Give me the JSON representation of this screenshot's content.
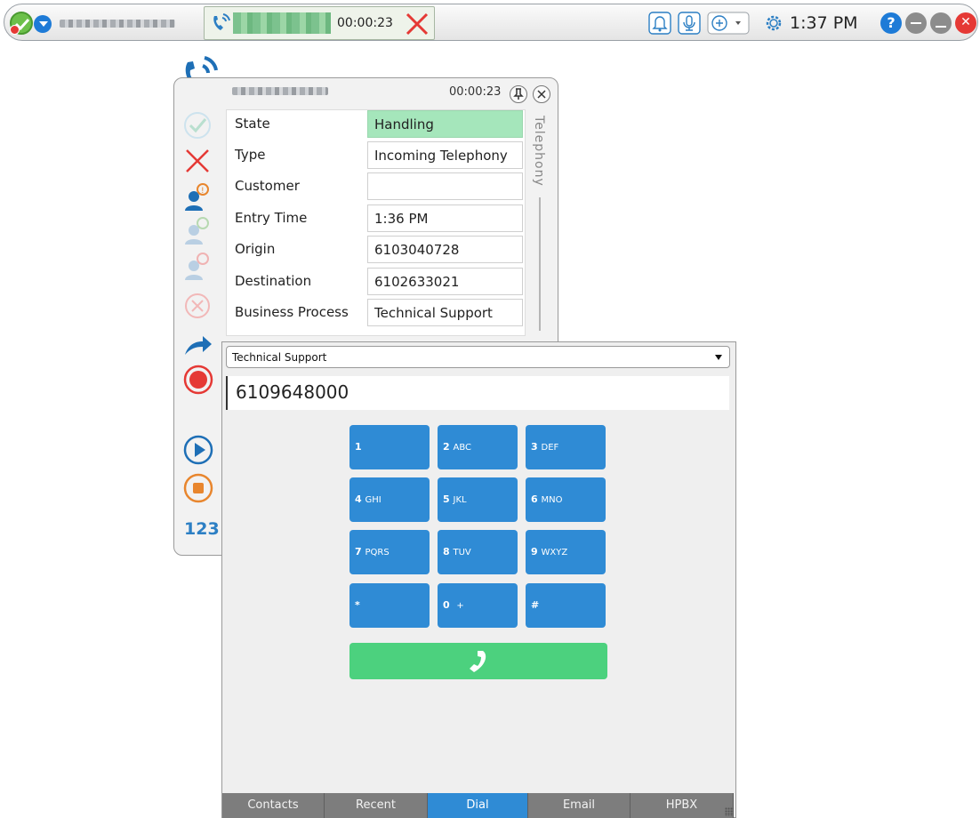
{
  "toolbar": {
    "call_timer": "00:00:23",
    "clock": "1:37 PM",
    "help_label": "?",
    "close_label": "✕"
  },
  "interaction": {
    "timer": "00:00:23",
    "side_label_123": "123",
    "tab_label": "Telephony",
    "fields": [
      {
        "label": "State",
        "value": "Handling"
      },
      {
        "label": "Type",
        "value": "Incoming Telephony"
      },
      {
        "label": "Customer",
        "value": ""
      },
      {
        "label": "Entry Time",
        "value": "1:36 PM"
      },
      {
        "label": "Origin",
        "value": "6103040728"
      },
      {
        "label": "Destination",
        "value": "6102633021"
      },
      {
        "label": "Business Process",
        "value": "Technical Support"
      }
    ]
  },
  "dialer": {
    "selected_process": "Technical Support",
    "number": "6109648000",
    "keys": [
      {
        "digit": "1",
        "letters": ""
      },
      {
        "digit": "2",
        "letters": "ABC"
      },
      {
        "digit": "3",
        "letters": "DEF"
      },
      {
        "digit": "4",
        "letters": "GHI"
      },
      {
        "digit": "5",
        "letters": "JKL"
      },
      {
        "digit": "6",
        "letters": "MNO"
      },
      {
        "digit": "7",
        "letters": "PQRS"
      },
      {
        "digit": "8",
        "letters": "TUV"
      },
      {
        "digit": "9",
        "letters": "WXYZ"
      },
      {
        "digit": "*",
        "letters": ""
      },
      {
        "digit": "0",
        "letters": "+"
      },
      {
        "digit": "#",
        "letters": ""
      }
    ],
    "tabs": [
      "Contacts",
      "Recent",
      "Dial",
      "Email",
      "HPBX"
    ],
    "active_tab": "Dial"
  },
  "colors": {
    "accent_blue": "#2f8bd5",
    "call_green": "#4cd17e",
    "state_green": "#a5e6bb",
    "hangup_red": "#e53935"
  }
}
